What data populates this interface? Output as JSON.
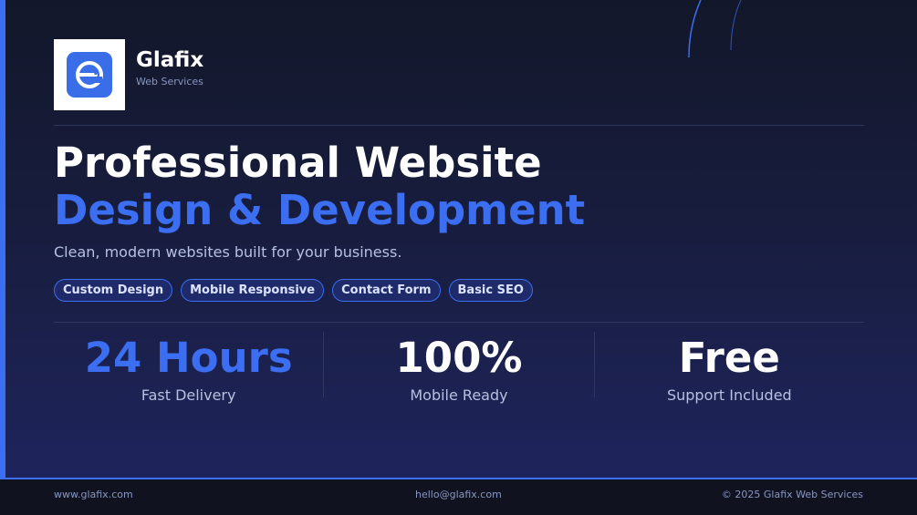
{
  "brand": {
    "name": "Glafix",
    "tagline": "Web Services",
    "logo_icon": "glafix-e-logo"
  },
  "hero": {
    "line1": "Professional Website",
    "line2": "Design & Development",
    "subtitle": "Clean, modern websites built for your business."
  },
  "tags": [
    "Custom Design",
    "Mobile Responsive",
    "Contact Form",
    "Basic SEO"
  ],
  "stats": [
    {
      "value": "24 Hours",
      "label": "Fast Delivery"
    },
    {
      "value": "100%",
      "label": "Mobile Ready"
    },
    {
      "value": "Free",
      "label": "Support Included"
    }
  ],
  "footer": {
    "website": "www.glafix.com",
    "email": "hello@glafix.com",
    "copyright": "© 2025 Glafix Web Services"
  },
  "colors": {
    "accent": "#3b6ef0",
    "background_top": "#13172a",
    "background_bottom": "#1f2560"
  }
}
